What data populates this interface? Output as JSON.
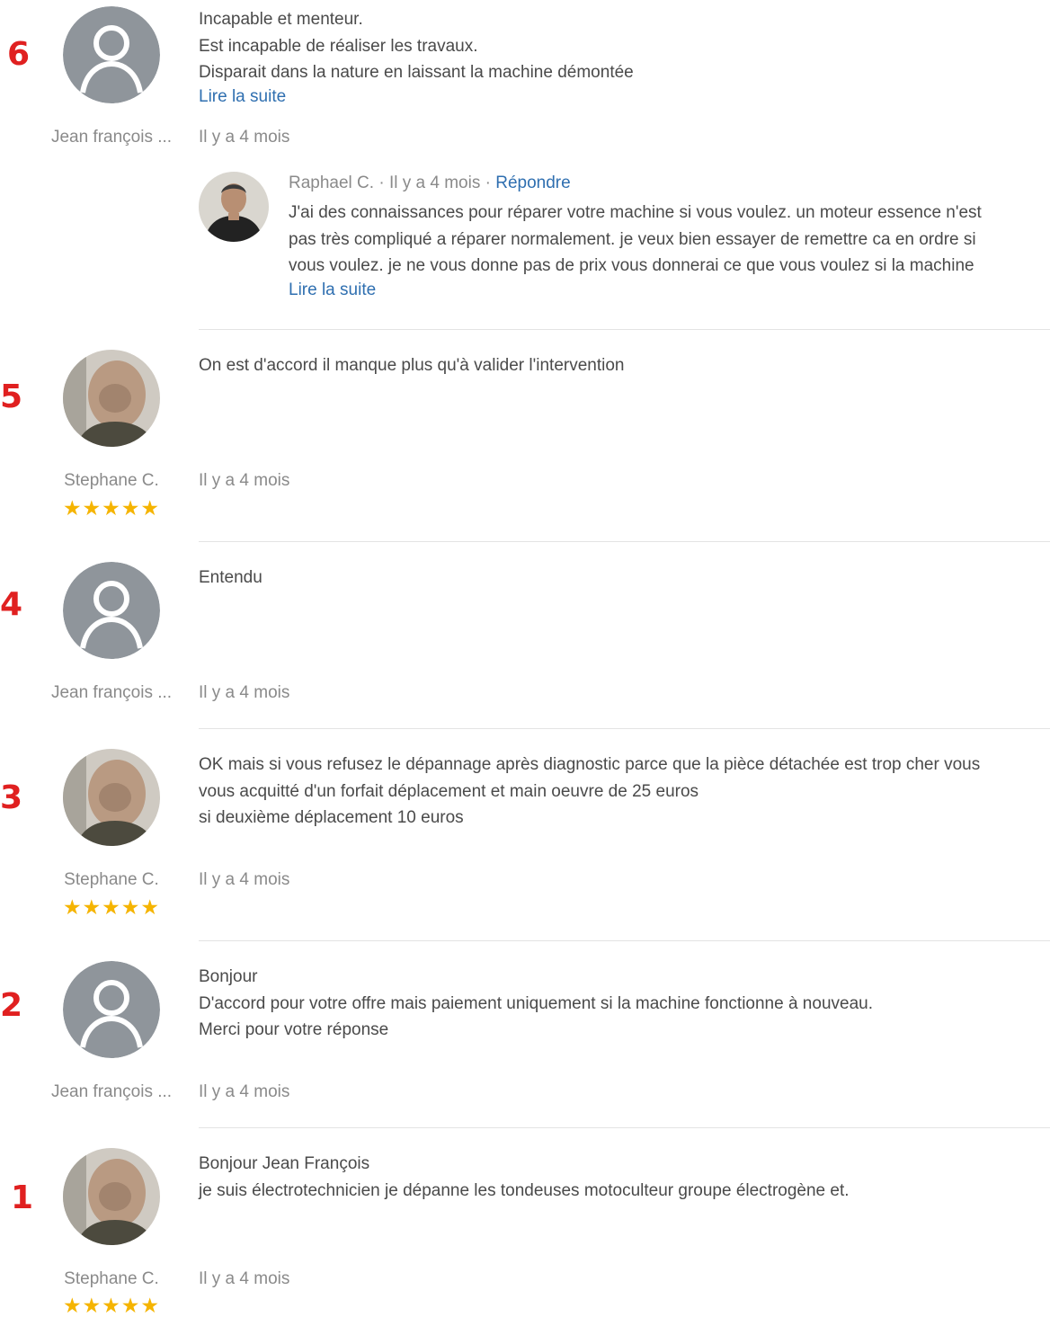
{
  "colors": {
    "marker": "#e02020",
    "link": "#2f6fb0",
    "star": "#f5b400",
    "text": "#4a4a4a",
    "muted": "#8a8a8a"
  },
  "comments": [
    {
      "marker": "6",
      "author": "Jean françois ...",
      "avatar": "default-user-avatar",
      "lines": [
        "Incapable et menteur.",
        "Est incapable de réaliser les travaux.",
        "Disparait dans la nature en laissant la machine démontée"
      ],
      "read_more": "Lire la suite",
      "date": "Il y a 4 mois",
      "reply": {
        "author": "Raphael C.",
        "separator": "·",
        "date": "Il y a 4 mois",
        "action": "Répondre",
        "lines": [
          "J'ai des connaissances pour réparer votre machine si vous voulez. un moteur essence n'est",
          "pas très compliqué a réparer normalement. je veux bien essayer de remettre ca en ordre si",
          "vous voulez. je ne vous donne pas de prix vous donnerai ce que vous voulez si la machine"
        ],
        "read_more": "Lire la suite"
      }
    },
    {
      "marker": "5",
      "author": "Stephane C.",
      "avatar": "user-photo",
      "stars": "★★★★★",
      "lines": [
        "On est d'accord il manque plus qu'à valider l'intervention"
      ],
      "date": "Il y a 4 mois"
    },
    {
      "marker": "4",
      "author": "Jean françois ...",
      "avatar": "default-user-avatar",
      "lines": [
        "Entendu"
      ],
      "date": "Il y a 4 mois"
    },
    {
      "marker": "3",
      "author": "Stephane C.",
      "avatar": "user-photo",
      "stars": "★★★★★",
      "lines": [
        "OK mais si vous refusez le dépannage après diagnostic parce que la pièce détachée est trop cher vous",
        "vous acquitté d'un forfait déplacement et main oeuvre de 25 euros",
        "si deuxième déplacement 10 euros"
      ],
      "date": "Il y a 4 mois"
    },
    {
      "marker": "2",
      "author": "Jean françois ...",
      "avatar": "default-user-avatar",
      "lines": [
        "Bonjour",
        "D'accord pour votre offre mais paiement uniquement si la machine fonctionne à nouveau.",
        "Merci pour votre réponse"
      ],
      "date": "Il y a 4 mois"
    },
    {
      "marker": "1",
      "author": "Stephane C.",
      "avatar": "user-photo",
      "stars": "★★★★★",
      "lines": [
        "Bonjour Jean François",
        "je suis électrotechnicien je dépanne les tondeuses motoculteur groupe électrogène et."
      ],
      "date": "Il y a 4 mois"
    }
  ]
}
